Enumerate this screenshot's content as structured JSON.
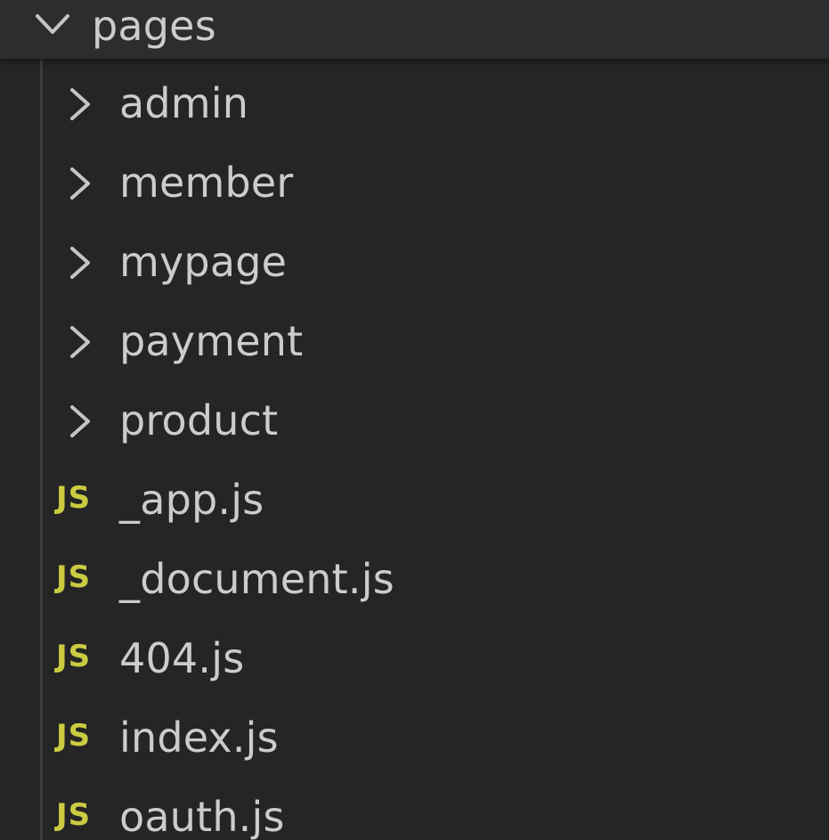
{
  "explorer": {
    "folder": {
      "label": "pages",
      "expanded": true,
      "icon": "chevron-down-icon"
    },
    "items": [
      {
        "type": "folder",
        "label": "admin",
        "icon": "chevron-right-icon"
      },
      {
        "type": "folder",
        "label": "member",
        "icon": "chevron-right-icon"
      },
      {
        "type": "folder",
        "label": "mypage",
        "icon": "chevron-right-icon"
      },
      {
        "type": "folder",
        "label": "payment",
        "icon": "chevron-right-icon"
      },
      {
        "type": "folder",
        "label": "product",
        "icon": "chevron-right-icon"
      },
      {
        "type": "file",
        "label": "_app.js",
        "icon": "js-file-icon",
        "icon_text": "JS"
      },
      {
        "type": "file",
        "label": "_document.js",
        "icon": "js-file-icon",
        "icon_text": "JS"
      },
      {
        "type": "file",
        "label": "404.js",
        "icon": "js-file-icon",
        "icon_text": "JS"
      },
      {
        "type": "file",
        "label": "index.js",
        "icon": "js-file-icon",
        "icon_text": "JS"
      },
      {
        "type": "file",
        "label": "oauth.js",
        "icon": "js-file-icon",
        "icon_text": "JS"
      }
    ]
  },
  "colors": {
    "background": "#252526",
    "header_background": "#2c2d2e",
    "text": "#cccccc",
    "js_icon": "#cbcb41",
    "indent_guide": "#3d3d3d"
  }
}
